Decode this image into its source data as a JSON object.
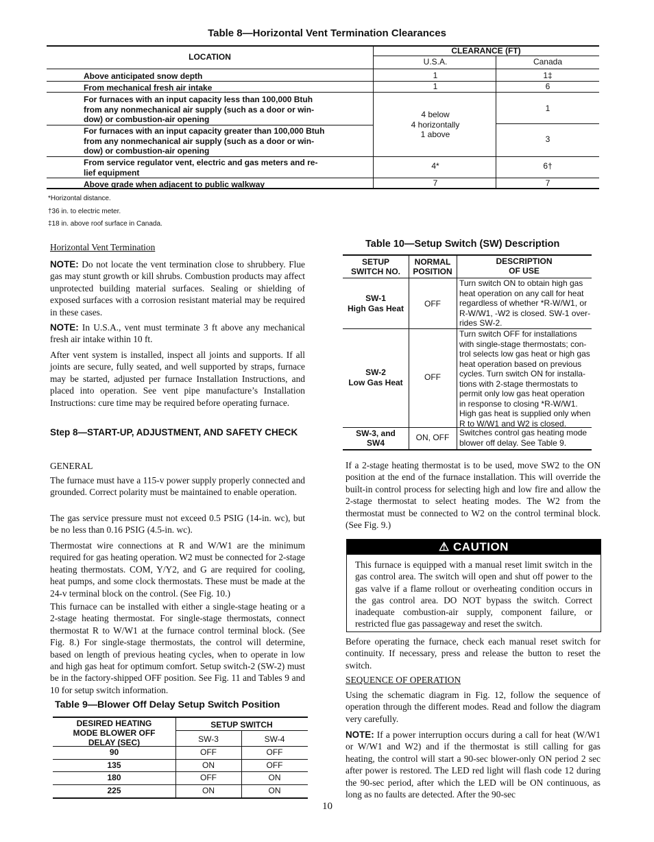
{
  "page_number": "10",
  "table8": {
    "title": "Table 8—Horizontal Vent Termination Clearances",
    "headers": {
      "location": "LOCATION",
      "clearance": "CLEARANCE (FT)",
      "usa": "U.S.A.",
      "canada": "Canada"
    },
    "rows": [
      {
        "location": "Above anticipated snow depth",
        "usa": "1",
        "canada": "1‡"
      },
      {
        "location": "From mechanical fresh air intake",
        "usa": "1",
        "canada": "6"
      },
      {
        "location_lines": [
          "For furnaces with an input capacity less than 100,000 Btuh",
          "from any nonmechanical air supply (such as a door or win-",
          "dow) or combustion-air opening"
        ],
        "canada": "1"
      },
      {
        "location_lines": [
          "For furnaces with an input capacity greater than 100,000 Btuh",
          "from any nonmechanical air supply (such as a door or win-",
          "dow) or combustion-air opening"
        ],
        "canada": "3"
      },
      {
        "location_lines": [
          "From service regulator vent, electric and gas meters and re-",
          "lief equipment"
        ],
        "usa": "4*",
        "canada": "6†"
      },
      {
        "location": "Above grade when adjacent to public walkway",
        "usa": "7",
        "canada": "7"
      }
    ],
    "merged_usa_lines": [
      "4 below",
      "4 horizontally",
      "1 above"
    ],
    "footnotes": [
      "*Horizontal distance.",
      "†36 in. to electric meter.",
      "‡18 in. above roof surface in Canada."
    ]
  },
  "left": {
    "heading_vent": "Horizontal Vent Termination",
    "note1_label": "NOTE:",
    "note1_text": " Do not locate the vent termination close to shrubbery. Flue gas may stunt growth or kill shrubs. Combustion products may affect unprotected building material surfaces. Sealing or shielding of exposed surfaces with a corrosion resistant material may be required in these cases.",
    "note2_label": "NOTE:",
    "note2_text": " In U.S.A., vent must terminate 3 ft above any mechanical fresh air intake within 10 ft.",
    "para_after_vent": "After vent system is installed, inspect all joints and supports. If all joints are secure, fully seated, and well supported by straps, furnace may be started, adjusted per furnace Installation Instructions, and placed into operation. See vent pipe manufacture’s Installation Instructions: cure time may be required before operating furnace.",
    "step8_heading": "Step 8—START-UP, ADJUSTMENT, AND SAFETY CHECK",
    "general_heading": "GENERAL",
    "p_power": "The furnace must have a 115-v power supply properly connected and grounded. Correct polarity must be maintained to enable operation.",
    "p_gas": "The gas service pressure must not exceed 0.5 PSIG (14-in. wc), but be no less than 0.16 PSIG (4.5-in. wc).",
    "p_thermostat": "Thermostat wire connections at R and W/W1 are the minimum required for gas heating operation. W2 must be connected for 2-stage heating thermostats. COM, Y/Y2, and G are required for cooling, heat pumps, and some clock thermostats. These must be made at the 24-v terminal block on the control. (See Fig. 10.)",
    "p_install": "This furnace can be installed with either a single-stage heating or a 2-stage heating thermostat. For single-stage thermostats, connect thermostat R to W/W1 at the furnace control terminal block. (See Fig. 8.) For single-stage thermostats, the control will determine, based on length of previous heating cycles, when to operate in low and high gas heat for optimum comfort. Setup switch-2 (SW-2) must be in the factory-shipped OFF position. See Fig. 11 and Tables 9 and 10 for setup switch information."
  },
  "table9": {
    "title": "Table 9—Blower Off Delay Setup Switch Position",
    "header_delay_lines": [
      "DESIRED HEATING",
      "MODE BLOWER OFF",
      "DELAY (SEC)"
    ],
    "header_setup": "SETUP SWITCH",
    "header_sw3": "SW-3",
    "header_sw4": "SW-4",
    "rows": [
      {
        "delay": "90",
        "sw3": "OFF",
        "sw4": "OFF"
      },
      {
        "delay": "135",
        "sw3": "ON",
        "sw4": "OFF"
      },
      {
        "delay": "180",
        "sw3": "OFF",
        "sw4": "ON"
      },
      {
        "delay": "225",
        "sw3": "ON",
        "sw4": "ON"
      }
    ]
  },
  "table10": {
    "title": "Table 10—Setup Switch (SW) Description",
    "header_switch_lines": [
      "SETUP",
      "SWITCH NO."
    ],
    "header_position_lines": [
      "NORMAL",
      "POSITION"
    ],
    "header_desc_lines": [
      "DESCRIPTION",
      "OF USE"
    ],
    "rows": [
      {
        "switch_lines": [
          "SW-1",
          "High Gas Heat"
        ],
        "position": "OFF",
        "desc_lines": [
          "Turn switch ON to obtain high gas",
          "heat operation on any call for heat",
          "regardless of whether *R-W/W1, or",
          "R-W/W1, -W2 is closed. SW-1 over-",
          "rides SW-2."
        ]
      },
      {
        "switch_lines": [
          "SW-2",
          "Low Gas Heat"
        ],
        "position": "OFF",
        "desc_lines": [
          "Turn switch OFF for installations",
          "with single-stage thermostats; con-",
          "trol selects low gas heat or high gas",
          "heat operation based on previous",
          "cycles. Turn switch ON for installa-",
          "tions with 2-stage thermostats to",
          "permit only low gas heat operation",
          "in response to closing *R-W/W1.",
          "High gas heat is supplied only when",
          "R to W/W1 and W2 is closed."
        ]
      },
      {
        "switch_lines": [
          "SW-3, and",
          "SW4"
        ],
        "position": "ON, OFF",
        "desc_lines": [
          "Switches control gas heating mode",
          "blower off delay. See Table 9."
        ]
      }
    ]
  },
  "right": {
    "p_2stage": "If a 2-stage heating thermostat is to be used, move SW2 to the ON position at the end of the furnace installation. This will override the built-in control process for selecting high and low fire and allow the 2-stage thermostat to select heating modes. The W2 from the thermostat must be connected to W2 on the control terminal block. (See Fig. 9.)",
    "caution_icon": "warning-triangle",
    "caution_title": "CAUTION",
    "caution_text": "This furnace is equipped with a manual reset limit switch in the gas control area. The switch will open and shut off power to the gas valve if a flame rollout or overheating condition occurs in the gas control area. DO NOT bypass the switch. Correct inadequate combustion-air supply, component failure, or restricted flue gas passageway and reset the switch.",
    "p_before": "Before operating the furnace, check each manual reset switch for continuity. If necessary, press and release the button to reset the switch.",
    "sequence_heading": "SEQUENCE OF OPERATION",
    "p_sequence": "Using the schematic diagram in Fig. 12, follow the sequence of operation through the different modes. Read and follow the diagram very carefully.",
    "note3_label": "NOTE:",
    "note3_text": " If a power interruption occurs during a call for heat (W/W1 or W/W1 and W2) and if the thermostat is still calling for gas heating, the control will start a 90-sec blower-only ON period 2 sec after power is restored. The LED red light will flash code 12 during the 90-sec period, after which the LED will be ON continuous, as long as no faults are detected. After the 90-sec"
  }
}
